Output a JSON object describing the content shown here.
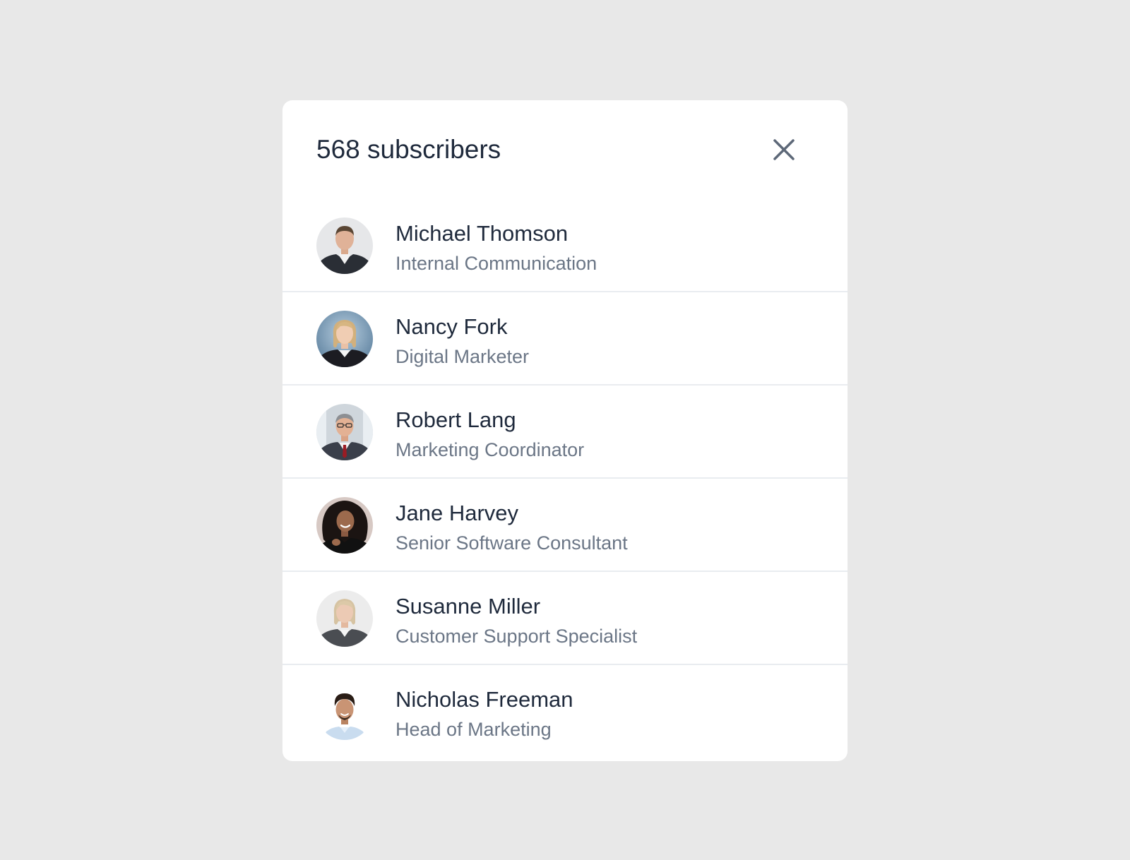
{
  "modal": {
    "title": "568 subscribers",
    "close_icon": "close-icon"
  },
  "subscribers": [
    {
      "name": "Michael Thomson",
      "role": "Internal Communication",
      "avatar": "avatar-photo"
    },
    {
      "name": "Nancy Fork",
      "role": "Digital Marketer",
      "avatar": "avatar-photo"
    },
    {
      "name": "Robert Lang",
      "role": "Marketing Coordinator",
      "avatar": "avatar-photo"
    },
    {
      "name": "Jane Harvey",
      "role": "Senior Software Consultant",
      "avatar": "avatar-photo"
    },
    {
      "name": "Susanne Miller",
      "role": "Customer Support Specialist",
      "avatar": "avatar-photo"
    },
    {
      "name": "Nicholas Freeman",
      "role": "Head of Marketing",
      "avatar": "avatar-photo"
    }
  ],
  "colors": {
    "background": "#e8e8e8",
    "card": "#ffffff",
    "title_text": "#1f2a3c",
    "secondary_text": "#6b7686",
    "divider": "#e9ecf0",
    "close_icon": "#5d6878"
  }
}
